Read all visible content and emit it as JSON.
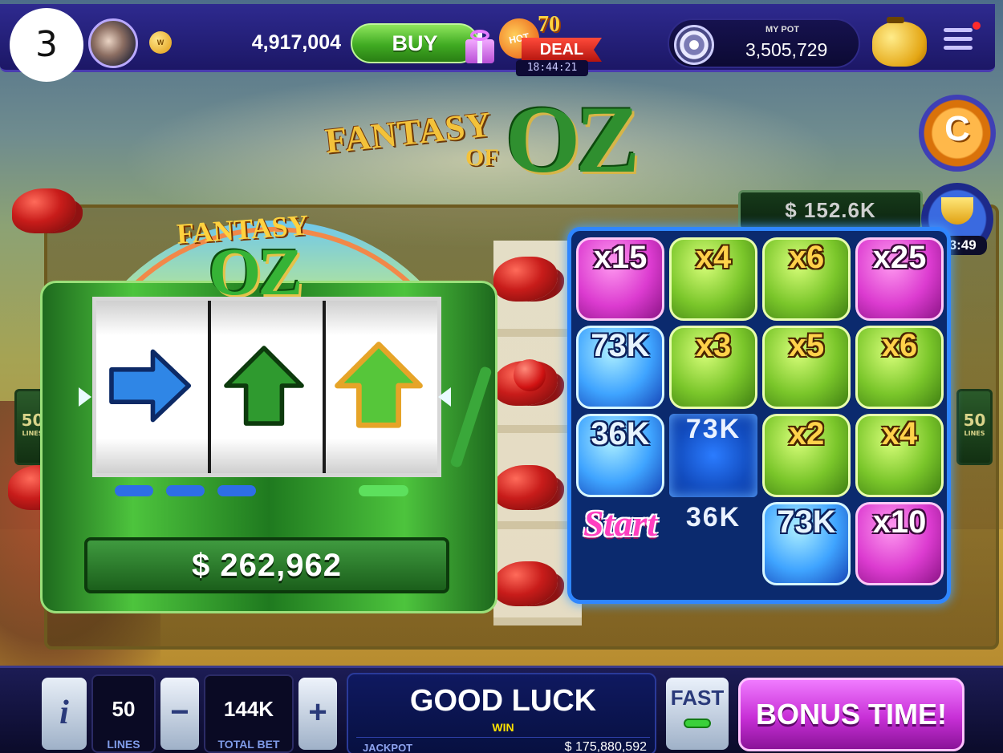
{
  "step_number": "3",
  "top_bar": {
    "vip_badge": "W",
    "balance": "4,917,004",
    "buy_label": "BUY",
    "deal": {
      "hot_label": "HOT",
      "number_label": "70",
      "deal_label": "DEAL",
      "timer": "18:44:21"
    },
    "pot": {
      "label": "MY POT",
      "value": "3,505,729"
    },
    "icons": [
      "avatar",
      "vip-coin-icon",
      "gift-icon",
      "pot-icon",
      "piggy-bank-icon",
      "menu-icon",
      "notification-dot"
    ]
  },
  "side_buttons": {
    "trophy_timer": "03:49",
    "icons": [
      "coin-icon",
      "trophy-icon"
    ]
  },
  "game": {
    "title_line1": "FANTASY",
    "title_of": "OF",
    "title_line2": "OZ",
    "background_pot": "$ 152.6K",
    "side_lines_value": "50",
    "side_lines_label": "LINES"
  },
  "mini_slot": {
    "logo_line1": "FANTASY",
    "logo_line2": "OZ",
    "reels": [
      {
        "symbol": "arrow-right",
        "color": "#2f86e6"
      },
      {
        "symbol": "arrow-up",
        "color": "#2f9a2f"
      },
      {
        "symbol": "arrow-up",
        "color": "#56c63a"
      }
    ],
    "win_amount": "$ 262,962"
  },
  "bonus_board": {
    "cells": [
      {
        "text": "x15",
        "style": "pink"
      },
      {
        "text": "x4",
        "style": "green"
      },
      {
        "text": "x6",
        "style": "green"
      },
      {
        "text": "x25",
        "style": "pink"
      },
      {
        "text": "73K",
        "style": "blue"
      },
      {
        "text": "x3",
        "style": "green"
      },
      {
        "text": "x5",
        "style": "green"
      },
      {
        "text": "x6",
        "style": "green"
      },
      {
        "text": "36K",
        "style": "blue"
      },
      {
        "text": "73K",
        "style": "plain-active"
      },
      {
        "text": "x2",
        "style": "green"
      },
      {
        "text": "x4",
        "style": "green"
      },
      {
        "text": "Start",
        "style": "start"
      },
      {
        "text": "36K",
        "style": "plain"
      },
      {
        "text": "73K",
        "style": "blue"
      },
      {
        "text": "x10",
        "style": "pink"
      }
    ]
  },
  "bottom_bar": {
    "info_label": "i",
    "lines_value": "50",
    "lines_label": "LINES",
    "minus_label": "−",
    "bet_value": "144K",
    "bet_label": "TOTAL BET",
    "plus_label": "+",
    "message": "GOOD LUCK",
    "win_label": "WIN",
    "jackpot_label": "JACKPOT",
    "jackpot_value": "$ 175,880,592",
    "fast_label": "FAST",
    "bonus_label": "BONUS TIME!"
  },
  "colors": {
    "top_bar": "#2e2a8f",
    "buy_button": "#3faa22",
    "bonus_button": "#c72fd6",
    "board_border": "#2f86ff",
    "jackpot_win_text": "#ffe100"
  }
}
